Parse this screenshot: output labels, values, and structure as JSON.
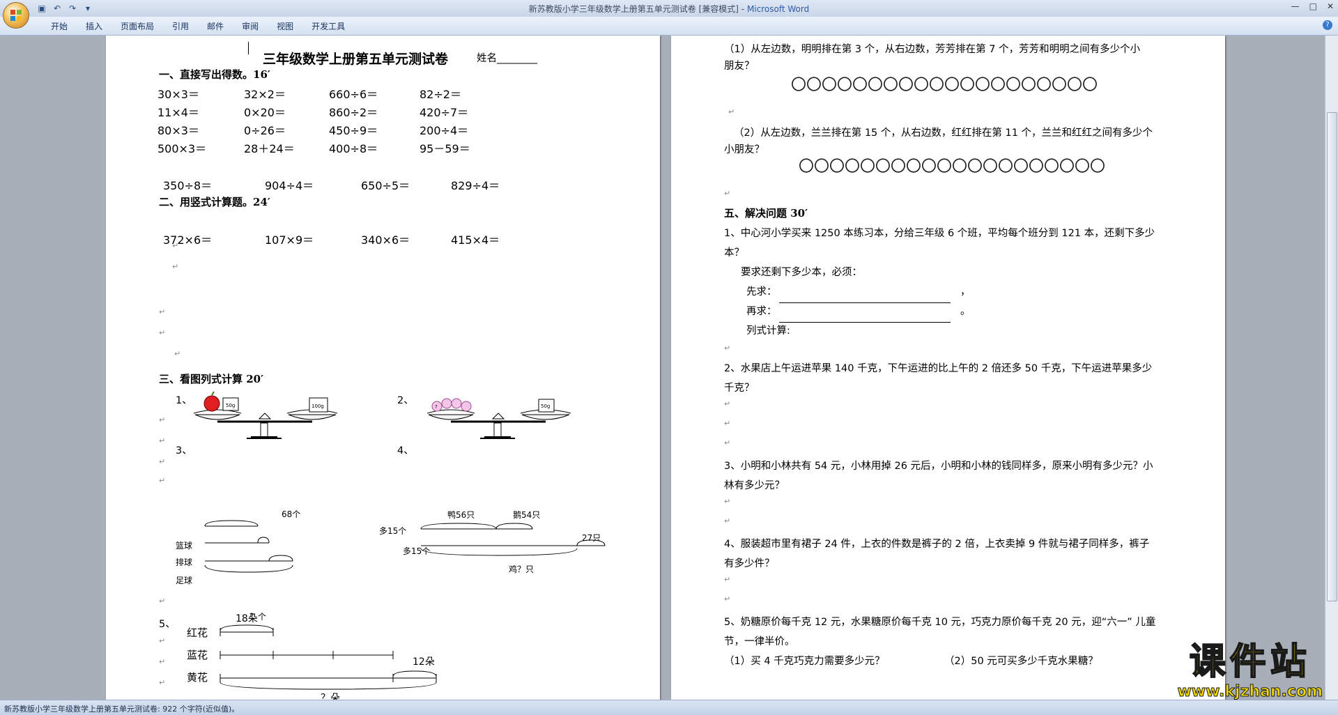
{
  "window": {
    "title": "新苏教版小学三年级数学上册第五单元测试卷 [兼容模式]",
    "title_separator": "-",
    "app_name": "Microsoft Word"
  },
  "menu": [
    "开始",
    "插入",
    "页面布局",
    "引用",
    "邮件",
    "审阅",
    "视图",
    "开发工具"
  ],
  "status_bar": "新苏教版小学三年级数学上册第五单元测试卷: 922 个字符(近似值)。",
  "left_page": {
    "title": "三年级数学上册第五单元测试卷",
    "name_label": "姓名________",
    "sec1": {
      "heading": "一、直接写出得数。16′",
      "rows": [
        [
          "30×3＝",
          "32×2＝",
          "660÷6＝",
          "82÷2＝"
        ],
        [
          "11×4＝",
          "0×20＝",
          "860÷2＝",
          "420÷7＝"
        ],
        [
          "80×3＝",
          "0÷26＝",
          "450÷9＝",
          "200÷4＝"
        ],
        [
          "500×3＝",
          "28＋24＝",
          "400÷8＝",
          "95－59＝"
        ]
      ]
    },
    "sec2": {
      "heading": "二、用竖式计算题。24′",
      "row1": [
        "350÷8＝",
        "904÷4＝",
        "650÷5＝",
        "829÷4＝"
      ],
      "row2": [
        "372×6＝",
        "107×9＝",
        "340×6＝",
        "415×4＝"
      ]
    },
    "sec3": {
      "heading": "三、看图列式计算 20′",
      "fig1": {
        "num": "1、",
        "w1": "50g",
        "w2": "100g"
      },
      "fig2": {
        "num": "2、",
        "w1": "50g",
        "flower": "?"
      },
      "fig3": {
        "num": "3、",
        "rows": [
          "篮球",
          "排球",
          "足球"
        ],
        "top": "68个",
        "more1": "多15个",
        "more2": "多15个",
        "q": "？个"
      },
      "fig4": {
        "num": "4、",
        "duck": "鸭56只",
        "goose": "鹅54只",
        "right": "27只",
        "q": "鸡？只"
      },
      "fig5": {
        "num": "5、",
        "rows": [
          "红花",
          "蓝花",
          "黄花"
        ],
        "top": "18朵",
        "right": "12朵",
        "q": "？朵"
      }
    }
  },
  "right_page": {
    "q1_line1": "（1）从左边数，明明排在第 3 个，从右边数，芳芳排在第 7 个，芳芳和明明之间有多少个小",
    "q1_line2": "朋友？",
    "circles1": "〇〇〇〇〇〇〇〇〇〇〇〇〇〇〇〇〇〇〇〇",
    "q2_line1": "（2）从左边数，兰兰排在第 15 个，从右边数，红红排在第 11 个，兰兰和红红之间有多少个",
    "q2_line2": "小朋友？",
    "circles2": "〇〇〇〇〇〇〇〇〇〇〇〇〇〇〇〇〇〇〇〇",
    "sec5": "五、解决问题 30′",
    "p1_l1": "1、中心河小学买来 1250 本练习本，分给三年级 6 个班，平均每个班分到 121 本，还剩下多少",
    "p1_l2": "本？",
    "p1_req": "要求还剩下多少本，必须：",
    "p1_first": "先求：",
    "p1_then": "再求：",
    "p1_calc": "列式计算:",
    "p2_l1": "2、水果店上午运进苹果 140 千克，下午运进的比上午的 2 倍还多 50 千克，下午运进苹果多少",
    "p2_l2": "千克？",
    "p3_l1": "3、小明和小林共有 54 元，小林用掉 26 元后，小明和小林的钱同样多，原来小明有多少元？小",
    "p3_l2": "林有多少元？",
    "p4_l1": "4、服装超市里有裙子 24 件，上衣的件数是裤子的 2 倍，上衣卖掉 9 件就与裙子同样多，裤子",
    "p4_l2": "有多少件？",
    "p5_l1": "5、奶糖原价每千克 12 元，水果糖原价每千克 10 元，巧克力原价每千克 20 元，迎“六一” 儿童",
    "p5_l2": "节，一律半价。",
    "p5_a": "（1）买 4 千克巧克力需要多少元？",
    "p5_b": "（2）50 元可买多少千克水果糖？"
  },
  "watermark": {
    "text": "课件站",
    "url": "www.kjzhan.com"
  }
}
